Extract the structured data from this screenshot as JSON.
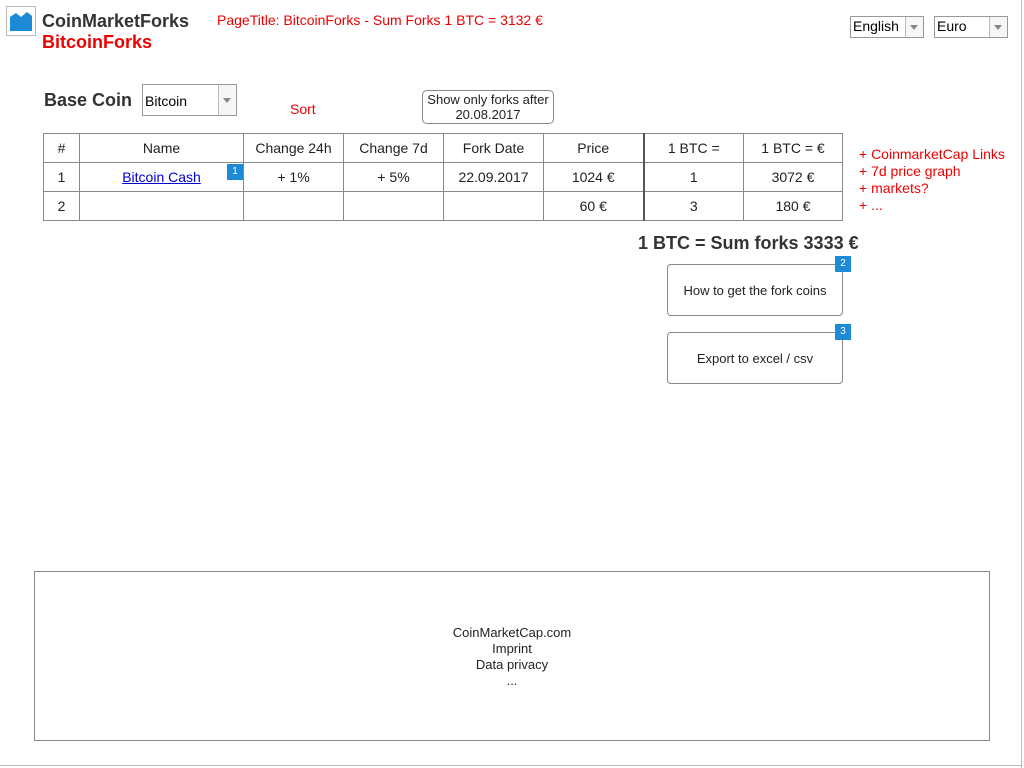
{
  "header": {
    "app_name": "CoinMarketForks",
    "sub_name": "BitcoinForks",
    "page_title": "PageTitle:  BitcoinForks - Sum Forks 1 BTC = 3132 €",
    "language": "English",
    "currency": "Euro"
  },
  "controls": {
    "base_coin_label": "Base Coin",
    "base_coin_value": "Bitcoin",
    "sort_label": "Sort",
    "forks_filter_line1": "Show only forks after",
    "forks_filter_line2": "20.08.2017"
  },
  "table": {
    "headers": [
      "#",
      "Name",
      "Change 24h",
      "Change 7d",
      "Fork Date",
      "Price",
      "1 BTC =",
      "1 BTC = €"
    ],
    "rows": [
      {
        "num": "1",
        "name": "Bitcoin Cash",
        "change24h": "+ 1%",
        "change7d": "+ 5%",
        "fork_date": "22.09.2017",
        "price": "1024 €",
        "per_btc": "1",
        "per_btc_eur": "3072 €"
      },
      {
        "num": "2",
        "name": "",
        "change24h": "",
        "change7d": "",
        "fork_date": "",
        "price": "60 €",
        "per_btc": "3",
        "per_btc_eur": "180 €"
      }
    ]
  },
  "badges": [
    "1",
    "2",
    "3"
  ],
  "notes": [
    "+ CoinmarketCap Links",
    "+ 7d price graph",
    "+ markets?",
    "+ ..."
  ],
  "summary": "1 BTC = Sum forks 3333 €",
  "actions": {
    "howto": "How to get the fork coins",
    "export": "Export to excel / csv"
  },
  "footer": [
    "CoinMarketCap.com",
    "Imprint",
    "Data privacy",
    "..."
  ],
  "colors": {
    "accent_red": "#e00000",
    "badge_blue": "#1c8ad6",
    "link_blue": "#0000cc"
  }
}
